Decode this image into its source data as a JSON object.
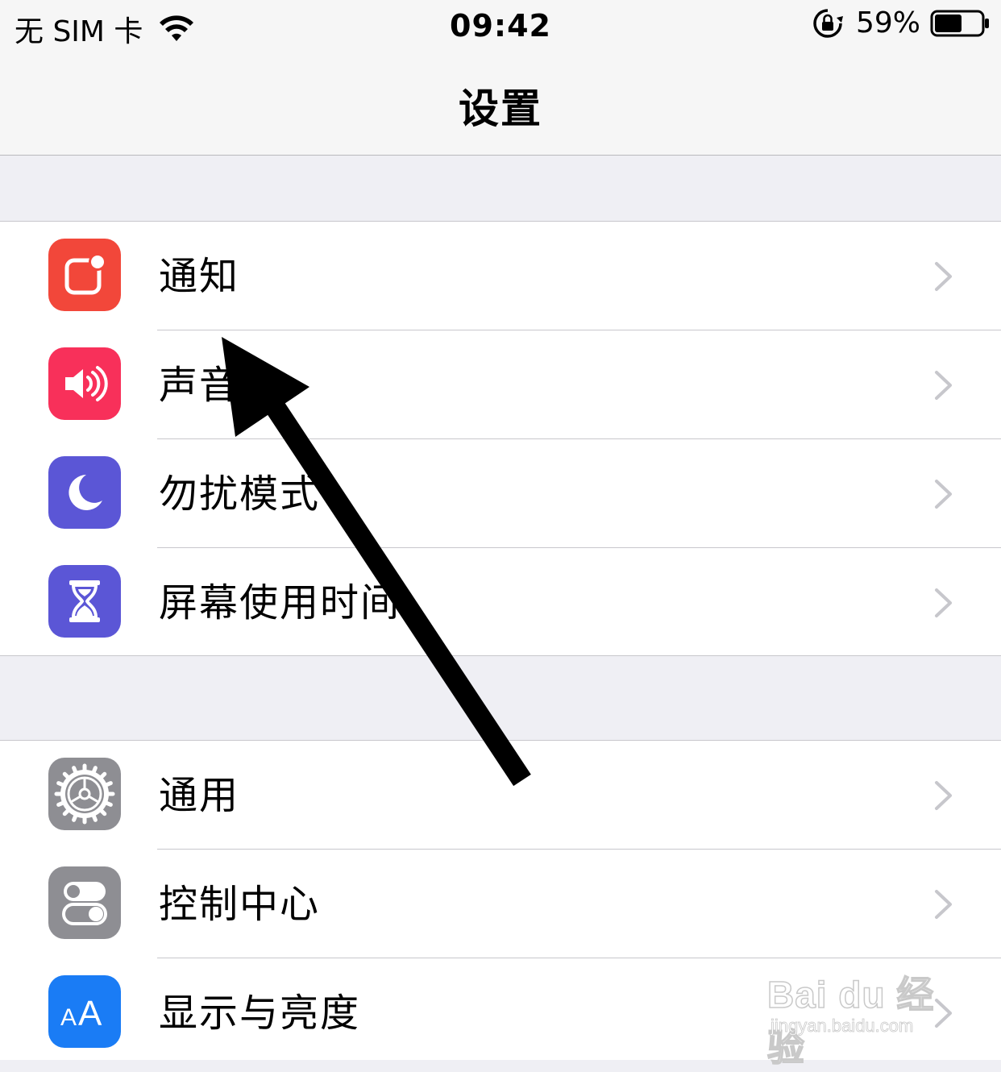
{
  "status_bar": {
    "carrier": "无 SIM 卡",
    "time": "09:42",
    "battery_percent": "59%",
    "battery_level": 0.59,
    "icons": [
      "wifi-icon",
      "orientation-lock-icon",
      "battery-icon"
    ]
  },
  "nav": {
    "title": "设置"
  },
  "groups": [
    {
      "items": [
        {
          "label": "通知",
          "icon": "notifications-icon",
          "color": "#f2473a"
        },
        {
          "label": "声音",
          "icon": "speaker-icon",
          "color": "#f8305a"
        },
        {
          "label": "勿扰模式",
          "icon": "moon-icon",
          "color": "#5b56d6"
        },
        {
          "label": "屏幕使用时间",
          "icon": "hourglass-icon",
          "color": "#5b56d6"
        }
      ]
    },
    {
      "items": [
        {
          "label": "通用",
          "icon": "gear-icon",
          "color": "#8e8e93"
        },
        {
          "label": "控制中心",
          "icon": "toggles-icon",
          "color": "#8e8e93"
        },
        {
          "label": "显示与亮度",
          "icon": "text-size-icon",
          "color": "#1a7cf5"
        }
      ]
    }
  ],
  "annotation": {
    "type": "arrow",
    "color": "#000000",
    "points_to": "通知"
  },
  "watermark": {
    "logo": "Bai du 经验",
    "url": "jingyan.baidu.com"
  },
  "colors": {
    "background": "#efeff4",
    "row": "#ffffff",
    "chevron": "#c7c7cc",
    "separator": "#c8c7cc"
  }
}
